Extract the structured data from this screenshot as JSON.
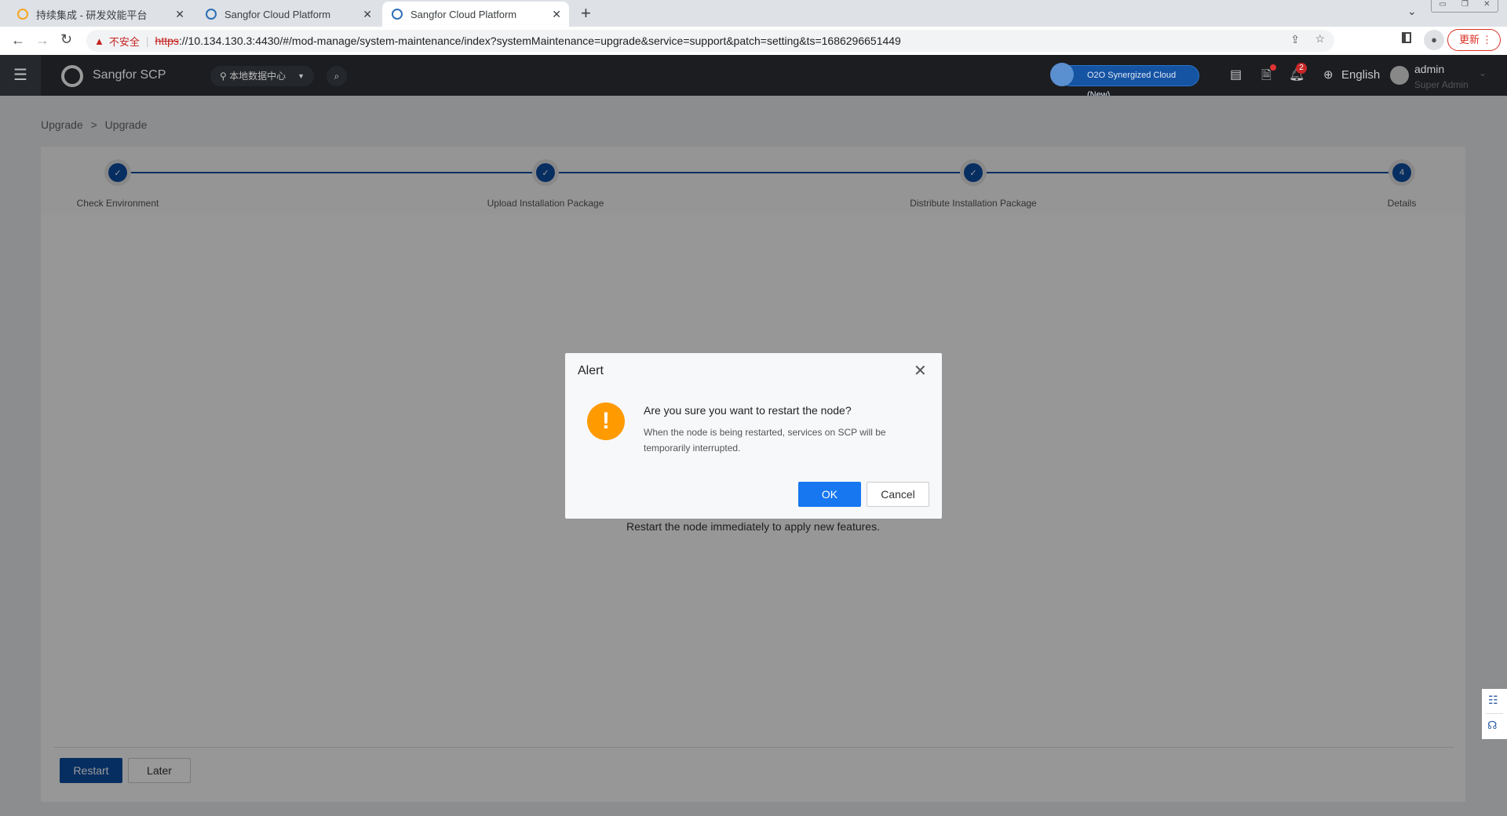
{
  "browser": {
    "tabs": [
      {
        "label": "持续集成 - 研发效能平台"
      },
      {
        "label": "Sangfor Cloud Platform"
      },
      {
        "label": "Sangfor Cloud Platform",
        "active": true
      }
    ],
    "security_label": "不安全",
    "url_scheme": "https",
    "url_rest": "://10.134.130.3:4430/#/mod-manage/system-maintenance/index?systemMaintenance=upgrade&service=support&patch=setting&ts=1686296651449",
    "update_label": "更新"
  },
  "header": {
    "brand": "Sangfor SCP",
    "location": "本地数据中心",
    "promo": "O2O Synergized Cloud (New)",
    "notification_count": "2",
    "language": "English",
    "user": "admin",
    "role": "Super Admin"
  },
  "breadcrumb": [
    "Upgrade",
    ">",
    "Upgrade"
  ],
  "steps": [
    {
      "label": "Check Environment",
      "status": "done"
    },
    {
      "label": "Upload Installation Package",
      "status": "done"
    },
    {
      "label": "Distribute Installation Package",
      "status": "done"
    },
    {
      "label": "Details",
      "number": "4",
      "status": "current"
    }
  ],
  "content": {
    "message": "Restart the node immediately to apply new features.",
    "restart": "Restart",
    "later": "Later"
  },
  "dialog": {
    "title": "Alert",
    "question": "Are you sure you want to restart the node?",
    "detail_1": "When the node is being restarted, services on SCP will be",
    "detail_2": "temporarily interrupted.",
    "ok": "OK",
    "cancel": "Cancel"
  },
  "colors": {
    "primary": "#0c4ea2",
    "dialog_ok": "#1677f0",
    "warning": "#ff9a00"
  }
}
